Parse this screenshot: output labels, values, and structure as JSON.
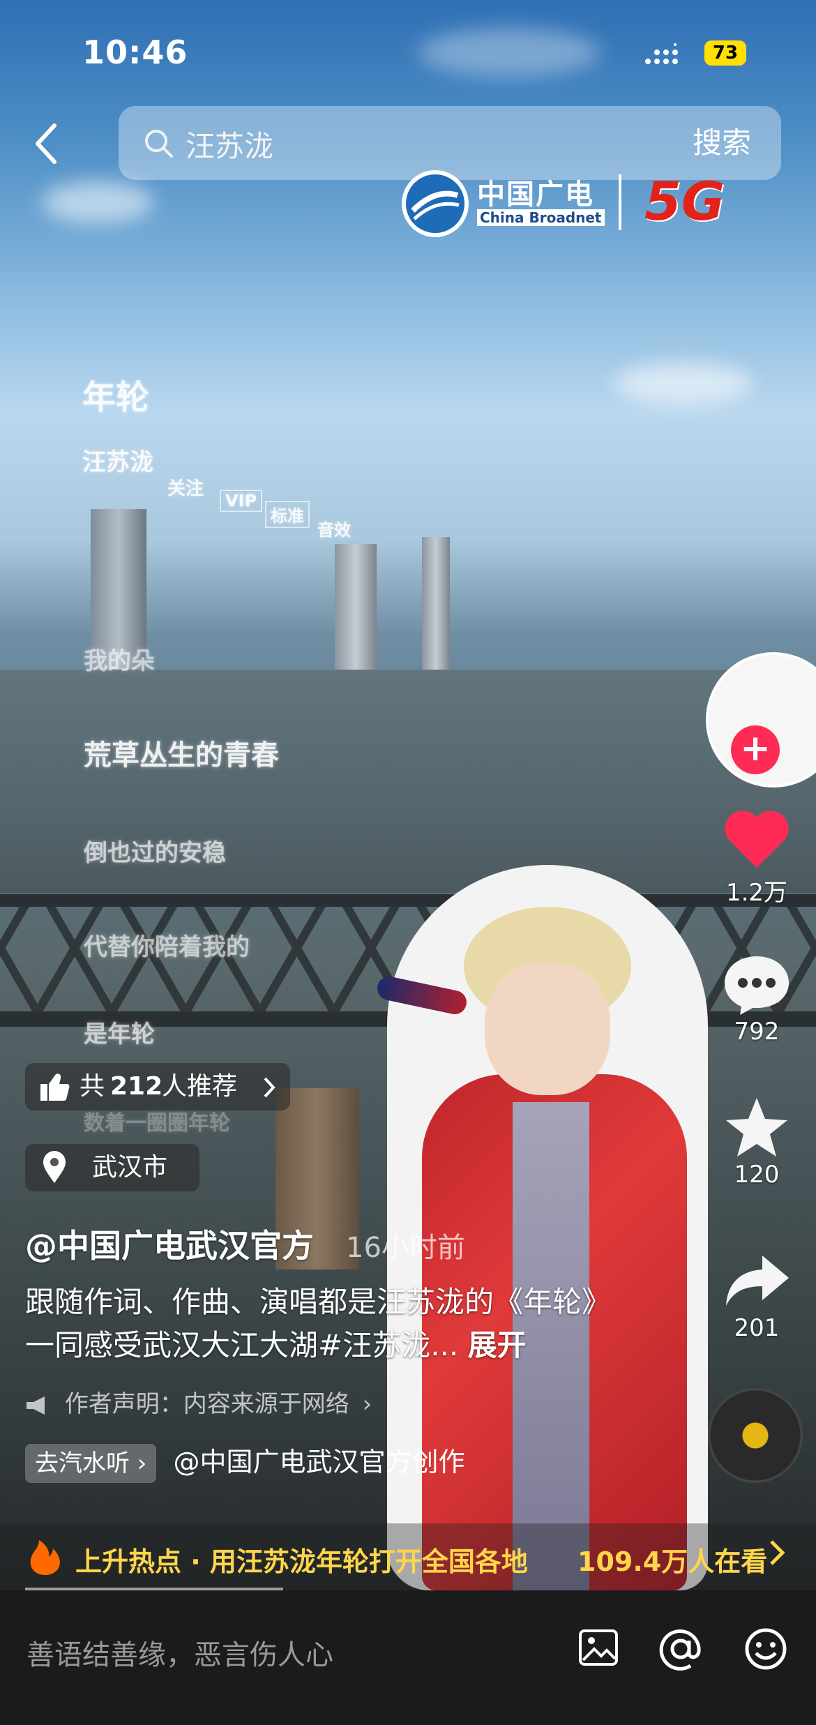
{
  "status_bar": {
    "time": "10:46",
    "battery": "73"
  },
  "search": {
    "query": "汪苏泷",
    "button": "搜索"
  },
  "logo": {
    "cn": "中国广电",
    "en": "China Broadnet",
    "network": "5G"
  },
  "lyrics": [
    "年轮",
    "汪苏泷",
    "关注",
    "VIP",
    "标准",
    "音效",
    "我的朵",
    "荒草丛生的青春",
    "倒也过的安稳",
    "代替你陪着我的",
    "是年轮",
    "数着一圈圈年轮"
  ],
  "actions": {
    "likes": "1.2万",
    "comments": "792",
    "favorites": "120",
    "shares": "201"
  },
  "recommend": {
    "label": "共",
    "count": "212",
    "suffix": "人推荐"
  },
  "location": {
    "text": "武汉市"
  },
  "post": {
    "author": "@中国广电武汉官方",
    "time_ago": "16小时前",
    "description": "跟随作词、作曲、演唱都是汪苏泷的《年轮》一同感受武汉大江大湖#汪苏泷...",
    "expand": "展开",
    "claim": "作者声明：内容来源于网络",
    "music_tag": "去汽水听",
    "music_credit": "@中国广电武汉官方创作"
  },
  "hot": {
    "text": "上升热点 · 用汪苏泷年轮打开全国各地",
    "viewers": "109.4万人在看"
  },
  "comment_input": {
    "placeholder": "善语结善缘，恶言伤人心"
  },
  "colors": {
    "like": "#fe2c55",
    "follow": "#fe2c55",
    "hot": "#ffd54a",
    "battery": "#ffe000"
  }
}
